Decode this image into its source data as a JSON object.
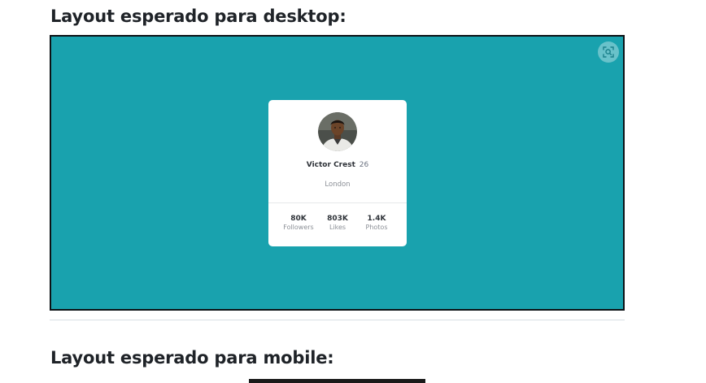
{
  "headings": {
    "desktop": "Layout esperado para desktop:",
    "mobile": "Layout esperado para mobile:"
  },
  "colors": {
    "preview_bg": "#19a2ae",
    "card_bg": "#ffffff",
    "text_dark": "#2e3238",
    "text_muted": "#8b8f96"
  },
  "preview": {
    "zoom_icon": "focus-zoom-icon"
  },
  "profile_card": {
    "avatar_icon": "avatar-photo",
    "name": "Victor Crest",
    "age": "26",
    "location": "London",
    "stats": [
      {
        "value": "80K",
        "label": "Followers"
      },
      {
        "value": "803K",
        "label": "Likes"
      },
      {
        "value": "1.4K",
        "label": "Photos"
      }
    ]
  }
}
